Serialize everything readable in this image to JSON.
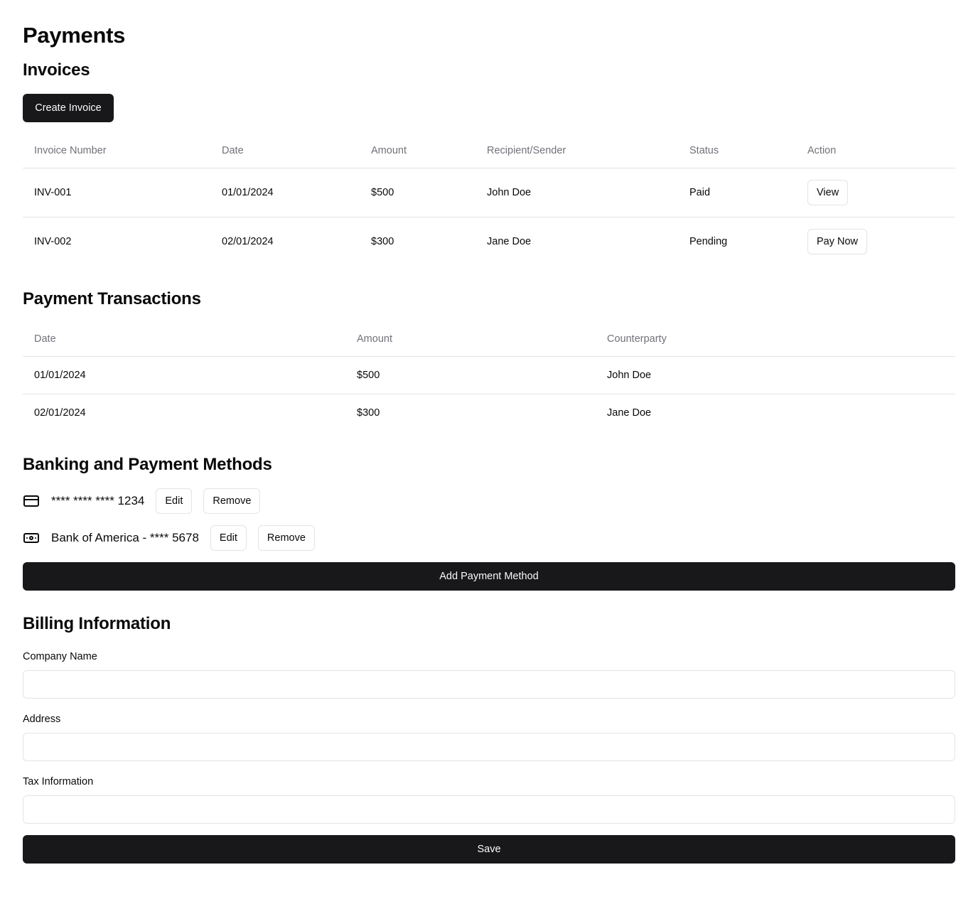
{
  "page": {
    "title": "Payments"
  },
  "invoices": {
    "title": "Invoices",
    "create_label": "Create Invoice",
    "columns": [
      "Invoice Number",
      "Date",
      "Amount",
      "Recipient/Sender",
      "Status",
      "Action"
    ],
    "rows": [
      {
        "number": "INV-001",
        "date": "01/01/2024",
        "amount": "$500",
        "party": "John Doe",
        "status": "Paid",
        "action": "View"
      },
      {
        "number": "INV-002",
        "date": "02/01/2024",
        "amount": "$300",
        "party": "Jane Doe",
        "status": "Pending",
        "action": "Pay Now"
      }
    ]
  },
  "transactions": {
    "title": "Payment Transactions",
    "columns": [
      "Date",
      "Amount",
      "Counterparty"
    ],
    "rows": [
      {
        "date": "01/01/2024",
        "amount": "$500",
        "counterparty": "John Doe"
      },
      {
        "date": "02/01/2024",
        "amount": "$300",
        "counterparty": "Jane Doe"
      }
    ]
  },
  "methods": {
    "title": "Banking and Payment Methods",
    "items": [
      {
        "icon": "credit-card-icon",
        "label": "**** **** **** 1234",
        "edit": "Edit",
        "remove": "Remove"
      },
      {
        "icon": "banknote-icon",
        "label": "Bank of America - **** 5678",
        "edit": "Edit",
        "remove": "Remove"
      }
    ],
    "add_label": "Add Payment Method"
  },
  "billing": {
    "title": "Billing Information",
    "fields": [
      {
        "label": "Company Name",
        "value": ""
      },
      {
        "label": "Address",
        "value": ""
      },
      {
        "label": "Tax Information",
        "value": ""
      }
    ],
    "save_label": "Save"
  }
}
